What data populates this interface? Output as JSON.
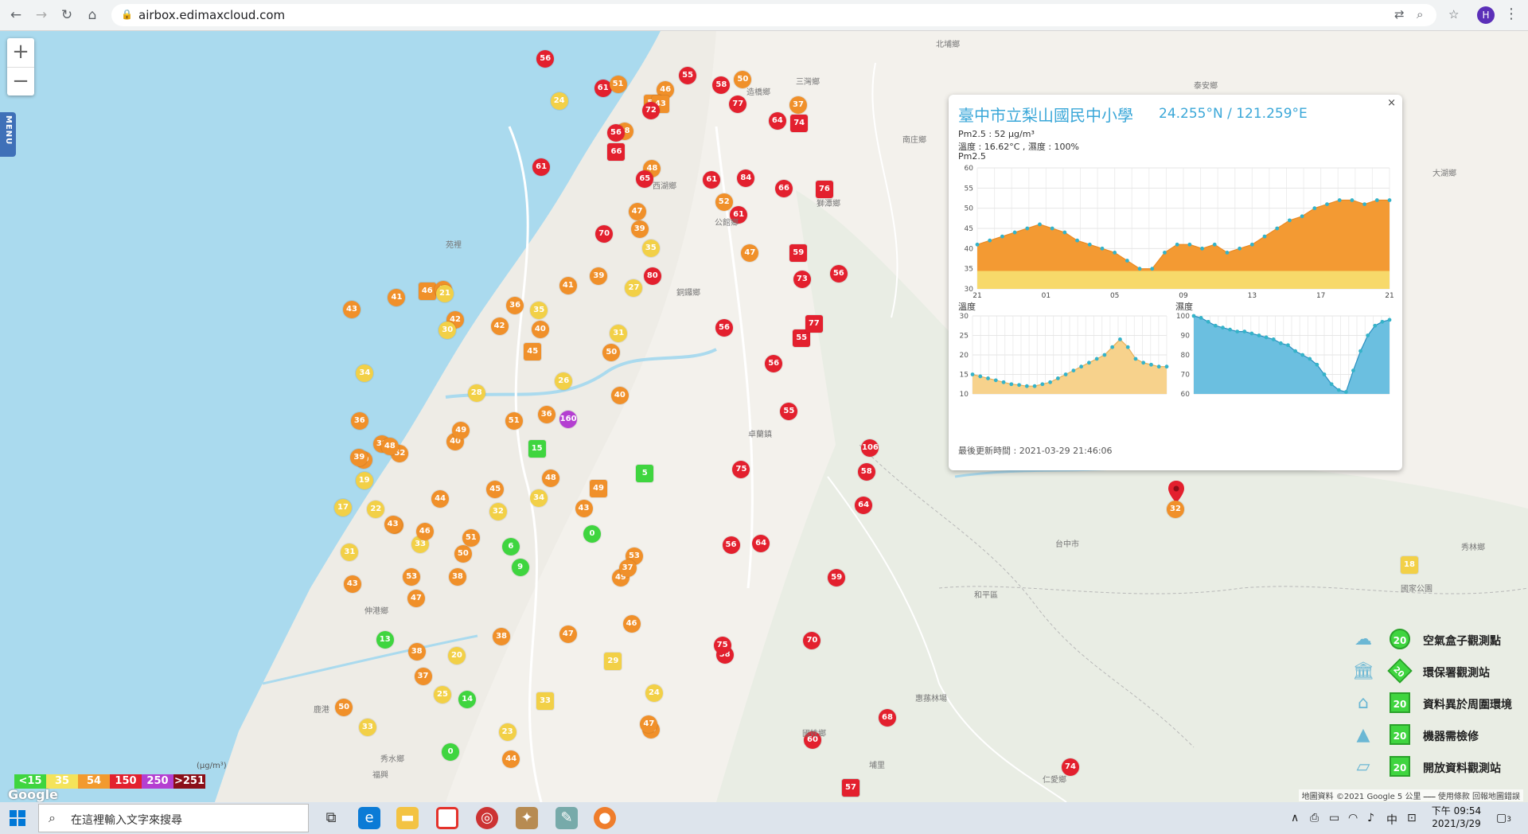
{
  "browser": {
    "url": "airbox.edimaxcloud.com",
    "profile_initial": "H"
  },
  "map": {
    "zoom_in": "+",
    "zoom_out": "−",
    "menu_label": "MENU",
    "place_labels": [
      "北埔鄉",
      "三灣鄉",
      "造橋鄉",
      "南庄鄉",
      "西湖鄉",
      "公館鄉",
      "獅潭鄉",
      "銅鑼鄉",
      "苑裡",
      "泰安鄉",
      "卓蘭鎮",
      "大湖鄉",
      "伸港鄉",
      "鹿港",
      "秀水鄉",
      "福興",
      "台中市",
      "國姓鄉",
      "惠蓀林場",
      "埔里",
      "仁愛鄉",
      "國家公園",
      "秀林鄉",
      "和平區"
    ],
    "markers": [
      {
        "v": "55",
        "c": "red"
      },
      {
        "v": "48",
        "c": "orange"
      },
      {
        "v": "66",
        "c": "red"
      },
      {
        "v": "70",
        "c": "red"
      },
      {
        "v": "61",
        "c": "red"
      },
      {
        "v": "58",
        "c": "red"
      },
      {
        "v": "46",
        "c": "orange"
      },
      {
        "v": "73",
        "c": "red"
      },
      {
        "v": "80",
        "c": "red"
      },
      {
        "v": "65",
        "c": "red"
      },
      {
        "v": "61",
        "c": "red"
      },
      {
        "v": "53",
        "c": "orange"
      },
      {
        "v": "51",
        "c": "orange"
      },
      {
        "v": "38",
        "c": "orange"
      },
      {
        "v": "37",
        "c": "orange"
      },
      {
        "v": "43",
        "c": "orange"
      },
      {
        "v": "39",
        "c": "orange"
      },
      {
        "v": "24",
        "c": "yellow"
      },
      {
        "v": "56",
        "c": "red"
      },
      {
        "v": "52",
        "c": "orange"
      },
      {
        "v": "66",
        "c": "red"
      },
      {
        "v": "35",
        "c": "yellow"
      },
      {
        "v": "72",
        "c": "red"
      },
      {
        "v": "50",
        "c": "orange"
      },
      {
        "v": "47",
        "c": "orange"
      },
      {
        "v": "59",
        "c": "red"
      },
      {
        "v": "61",
        "c": "red"
      },
      {
        "v": "56",
        "c": "red"
      },
      {
        "v": "47",
        "c": "orange"
      },
      {
        "v": "39",
        "c": "orange"
      },
      {
        "v": "38",
        "c": "orange"
      },
      {
        "v": "58",
        "c": "red"
      },
      {
        "v": "49",
        "c": "orange"
      },
      {
        "v": "56",
        "c": "red"
      },
      {
        "v": "46",
        "c": "orange"
      },
      {
        "v": "47",
        "c": "orange"
      },
      {
        "v": "40",
        "c": "orange"
      },
      {
        "v": "41",
        "c": "orange"
      },
      {
        "v": "31",
        "c": "yellow"
      },
      {
        "v": "50",
        "c": "orange"
      },
      {
        "v": "36",
        "c": "orange"
      },
      {
        "v": "49",
        "c": "orange"
      },
      {
        "v": "64",
        "c": "red"
      },
      {
        "v": "77",
        "c": "red"
      },
      {
        "v": "56",
        "c": "red"
      },
      {
        "v": "45",
        "c": "orange"
      },
      {
        "v": "43",
        "c": "orange"
      },
      {
        "v": "0",
        "c": "green"
      },
      {
        "v": "36",
        "c": "orange"
      },
      {
        "v": "33",
        "c": "yellow"
      },
      {
        "v": "34",
        "c": "yellow"
      },
      {
        "v": "43",
        "c": "orange"
      },
      {
        "v": "50",
        "c": "orange"
      },
      {
        "v": "55",
        "c": "red"
      },
      {
        "v": "58",
        "c": "red"
      },
      {
        "v": "46",
        "c": "orange"
      },
      {
        "v": "39",
        "c": "orange"
      },
      {
        "v": "38",
        "c": "orange"
      },
      {
        "v": "53",
        "c": "orange"
      },
      {
        "v": "33",
        "c": "yellow"
      },
      {
        "v": "75",
        "c": "red"
      },
      {
        "v": "48",
        "c": "orange"
      },
      {
        "v": "0",
        "c": "green"
      },
      {
        "v": "64",
        "c": "red"
      },
      {
        "v": "56",
        "c": "red"
      },
      {
        "v": "76",
        "c": "red"
      },
      {
        "v": "61",
        "c": "red"
      },
      {
        "v": "45",
        "c": "orange"
      },
      {
        "v": "74",
        "c": "red"
      },
      {
        "v": "75",
        "c": "red"
      },
      {
        "v": "56",
        "c": "red"
      },
      {
        "v": "77",
        "c": "red"
      },
      {
        "v": "52",
        "c": "orange"
      },
      {
        "v": "37",
        "c": "orange"
      },
      {
        "v": "46",
        "c": "orange"
      },
      {
        "v": "51",
        "c": "orange"
      },
      {
        "v": "43",
        "c": "orange"
      },
      {
        "v": "55",
        "c": "red"
      },
      {
        "v": "57",
        "c": "red"
      },
      {
        "v": "64",
        "c": "red"
      },
      {
        "v": "59",
        "c": "red"
      },
      {
        "v": "51",
        "c": "orange"
      },
      {
        "v": "38",
        "c": "orange"
      },
      {
        "v": "47",
        "c": "orange"
      },
      {
        "v": "5",
        "c": "green"
      },
      {
        "v": "49",
        "c": "orange"
      },
      {
        "v": "84",
        "c": "red"
      },
      {
        "v": "70",
        "c": "red"
      },
      {
        "v": "40",
        "c": "orange"
      },
      {
        "v": "106",
        "c": "red"
      },
      {
        "v": "160",
        "c": "purple"
      },
      {
        "v": "13",
        "c": "green"
      },
      {
        "v": "15",
        "c": "green"
      },
      {
        "v": "9",
        "c": "green"
      },
      {
        "v": "14",
        "c": "green"
      },
      {
        "v": "6",
        "c": "green"
      },
      {
        "v": "60",
        "c": "red"
      },
      {
        "v": "68",
        "c": "red"
      },
      {
        "v": "74",
        "c": "red"
      },
      {
        "v": "57",
        "c": "red"
      },
      {
        "v": "18",
        "c": "yellow"
      },
      {
        "v": "39",
        "c": "orange"
      },
      {
        "v": "24",
        "c": "yellow"
      },
      {
        "v": "36",
        "c": "orange"
      },
      {
        "v": "43",
        "c": "orange"
      },
      {
        "v": "33",
        "c": "yellow"
      },
      {
        "v": "53",
        "c": "orange"
      },
      {
        "v": "42",
        "c": "orange"
      },
      {
        "v": "32",
        "c": "yellow"
      },
      {
        "v": "40",
        "c": "orange"
      },
      {
        "v": "44",
        "c": "orange"
      },
      {
        "v": "47",
        "c": "orange"
      },
      {
        "v": "50",
        "c": "orange"
      },
      {
        "v": "29",
        "c": "yellow"
      },
      {
        "v": "27",
        "c": "yellow"
      },
      {
        "v": "35",
        "c": "yellow"
      },
      {
        "v": "49",
        "c": "orange"
      },
      {
        "v": "45",
        "c": "orange"
      },
      {
        "v": "41",
        "c": "orange"
      },
      {
        "v": "38",
        "c": "orange"
      },
      {
        "v": "46",
        "c": "orange"
      },
      {
        "v": "44",
        "c": "orange"
      },
      {
        "v": "42",
        "c": "orange"
      },
      {
        "v": "48",
        "c": "orange"
      },
      {
        "v": "30",
        "c": "yellow"
      },
      {
        "v": "25",
        "c": "yellow"
      },
      {
        "v": "23",
        "c": "yellow"
      },
      {
        "v": "20",
        "c": "yellow"
      },
      {
        "v": "37",
        "c": "orange"
      },
      {
        "v": "34",
        "c": "yellow"
      },
      {
        "v": "31",
        "c": "yellow"
      },
      {
        "v": "28",
        "c": "yellow"
      },
      {
        "v": "26",
        "c": "yellow"
      },
      {
        "v": "22",
        "c": "yellow"
      },
      {
        "v": "19",
        "c": "yellow"
      },
      {
        "v": "17",
        "c": "yellow"
      },
      {
        "v": "21",
        "c": "yellow"
      }
    ],
    "selected_marker": "32"
  },
  "popup": {
    "close": "×",
    "title": "臺中市立梨山國民中小學",
    "coords": "24.255°N / 121.259°E",
    "pm25_line": "Pm2.5 : 52 μg/m³",
    "temp_line": "溫度 : 16.62°C , 濕度 : 100%",
    "chart_label": "Pm2.5",
    "temp_label": "溫度",
    "humid_label": "濕度",
    "updated": "最後更新時間 : 2021-03-29 21:46:06"
  },
  "chart_data": [
    {
      "type": "area",
      "title": "Pm2.5",
      "x_ticks": [
        "21",
        "01",
        "05",
        "09",
        "13",
        "17",
        "21"
      ],
      "ylim": [
        30,
        60
      ],
      "y_ticks": [
        30,
        35,
        40,
        45,
        50,
        55,
        60
      ],
      "values": [
        41,
        42,
        43,
        44,
        45,
        46,
        45,
        44,
        42,
        41,
        40,
        39,
        37,
        35,
        35,
        39,
        41,
        41,
        40,
        41,
        39,
        40,
        41,
        43,
        45,
        47,
        48,
        50,
        51,
        52,
        52,
        51,
        52,
        52
      ]
    },
    {
      "type": "area",
      "title": "溫度",
      "ylim": [
        10,
        30
      ],
      "y_ticks": [
        10,
        15,
        20,
        25,
        30
      ],
      "values": [
        15,
        14.5,
        14,
        13.5,
        13,
        12.5,
        12.3,
        12,
        12,
        12.5,
        13,
        14,
        15,
        16,
        17,
        18,
        19,
        20,
        22,
        24,
        22,
        19,
        18,
        17.5,
        17,
        17
      ]
    },
    {
      "type": "area",
      "title": "濕度",
      "ylim": [
        60,
        100
      ],
      "y_ticks": [
        60,
        70,
        80,
        90,
        100
      ],
      "values": [
        100,
        99,
        97,
        95,
        94,
        93,
        92,
        92,
        91,
        90,
        89,
        88,
        86,
        85,
        82,
        80,
        78,
        75,
        70,
        65,
        62,
        61,
        72,
        82,
        90,
        95,
        97,
        98
      ]
    }
  ],
  "legend": {
    "items": [
      {
        "label": "空氣盒子觀測點",
        "badge": "20",
        "icon": "cloud-icon"
      },
      {
        "label": "環保署觀測站",
        "badge": "20",
        "icon": "building-icon"
      },
      {
        "label": "資料異於周圍環境",
        "badge": "20",
        "icon": "house-icon"
      },
      {
        "label": "機器需檢修",
        "badge": "20",
        "icon": "cone-icon"
      },
      {
        "label": "開放資料觀測站",
        "badge": "20",
        "icon": "layers-icon"
      }
    ],
    "scale": [
      {
        "label": "<15",
        "color": "#3fd53f"
      },
      {
        "label": "35",
        "color": "#f4e35a"
      },
      {
        "label": "54",
        "color": "#f29a2e"
      },
      {
        "label": "150",
        "color": "#e3202e"
      },
      {
        "label": "250",
        "color": "#b43fd1"
      },
      {
        "label": ">251",
        "color": "#8b0f18"
      }
    ],
    "unit": "(μg/m³)"
  },
  "attribution": {
    "google": "Google",
    "text": "地圖資料 ©2021 Google   5 公里 ⎯⎯⎯   使用條款   回報地圖錯誤"
  },
  "taskbar": {
    "search_placeholder": "在這裡輸入文字來搜尋",
    "time": "下午 09:54",
    "date": "2021/3/29",
    "ime": "中",
    "notification_count": "3"
  },
  "colors": {
    "red": "#e3202e",
    "orange": "#f0902a",
    "yellow": "#f2d047",
    "green": "#3fd53f",
    "purple": "#b43fd1",
    "water": "#aadaee"
  }
}
